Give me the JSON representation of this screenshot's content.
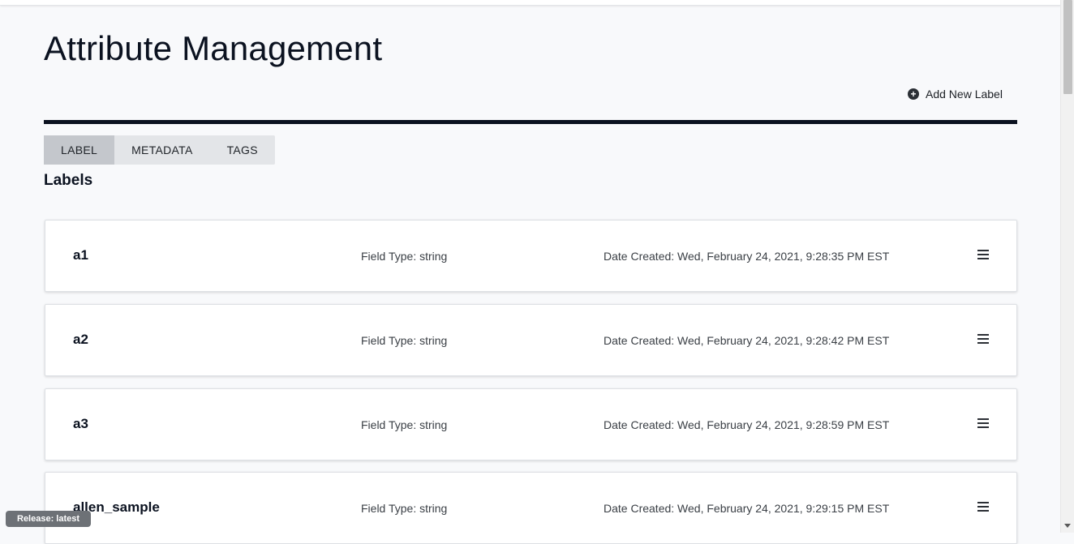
{
  "page": {
    "title": "Attribute Management"
  },
  "actions": {
    "add_label": "Add New Label"
  },
  "tabs": [
    {
      "label": "LABEL",
      "active": true
    },
    {
      "label": "METADATA",
      "active": false
    },
    {
      "label": "TAGS",
      "active": false
    }
  ],
  "section": {
    "title": "Labels"
  },
  "labels": [
    {
      "name": "a1",
      "field_type": "Field Type: string",
      "date_created": "Date Created: Wed, February 24, 2021, 9:28:35 PM EST"
    },
    {
      "name": "a2",
      "field_type": "Field Type: string",
      "date_created": "Date Created: Wed, February 24, 2021, 9:28:42 PM EST"
    },
    {
      "name": "a3",
      "field_type": "Field Type: string",
      "date_created": "Date Created: Wed, February 24, 2021, 9:28:59 PM EST"
    },
    {
      "name": "allen_sample",
      "field_type": "Field Type: string",
      "date_created": "Date Created: Wed, February 24, 2021, 9:29:15 PM EST"
    }
  ],
  "footer": {
    "release": "Release: latest"
  },
  "colors": {
    "header_divider": "#0b1220",
    "active_tab": "#c4c7cc",
    "tab_bar": "#e3e5e8",
    "background": "#f8f9fb"
  },
  "icons": {
    "add": "plus-circle-icon",
    "row_menu": "hamburger-menu-icon"
  }
}
